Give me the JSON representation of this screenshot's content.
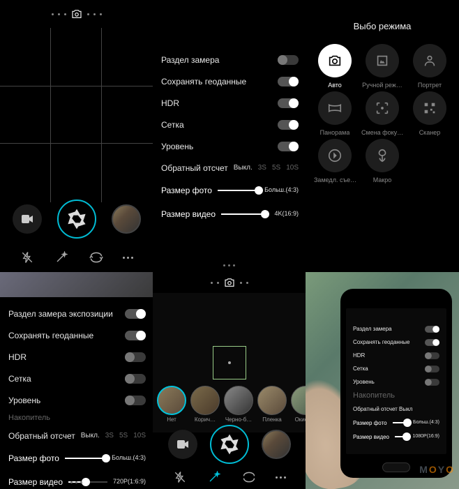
{
  "panel1": {
    "mode_icon": "camera-icon"
  },
  "panel2": {
    "rows": [
      {
        "label": "Раздел замера",
        "on": false
      },
      {
        "label": "Сохранять геоданные",
        "on": true
      },
      {
        "label": "HDR",
        "on": true
      },
      {
        "label": "Сетка",
        "on": true
      },
      {
        "label": "Уровень",
        "on": true
      }
    ],
    "timer_label": "Обратный отсчет",
    "timer_opts": [
      "Выкл.",
      "3S",
      "5S",
      "10S"
    ],
    "timer_sel": "Выкл.",
    "photo_size_label": "Размер фото",
    "photo_size_val": "Больш.(4:3)",
    "photo_size_pct": 100,
    "video_size_label": "Размер видео",
    "video_size_val": "4K(16:9)",
    "video_size_pct": 100
  },
  "panel3": {
    "title": "Выбо режима",
    "modes": [
      {
        "icon": "camera",
        "label": "Авто",
        "active": true
      },
      {
        "icon": "manual",
        "label": "Ручной реж…",
        "active": false
      },
      {
        "icon": "portrait",
        "label": "Портрет",
        "active": false
      },
      {
        "icon": "panorama",
        "label": "Панорама",
        "active": false
      },
      {
        "icon": "focus",
        "label": "Смена фоку…",
        "active": false
      },
      {
        "icon": "qr",
        "label": "Сканер",
        "active": false
      },
      {
        "icon": "slowmo",
        "label": "Замедл. съе…",
        "active": false
      },
      {
        "icon": "macro",
        "label": "Макро",
        "active": false
      }
    ]
  },
  "panel4": {
    "rows": [
      {
        "label": "Раздел замера экспозиции",
        "on": true
      },
      {
        "label": "Сохранять геоданные",
        "on": true
      },
      {
        "label": "HDR",
        "on": false
      },
      {
        "label": "Сетка",
        "on": false
      },
      {
        "label": "Уровень",
        "on": false
      }
    ],
    "storage_hdr": "Накопитель",
    "timer_label": "Обратный отсчет",
    "timer_opts": [
      "Выкл.",
      "3S",
      "5S",
      "10S"
    ],
    "timer_sel": "Выкл.",
    "photo_size_label": "Размер фото",
    "photo_size_val": "Больш.(4:3)",
    "photo_size_pct": 100,
    "video_size_label": "Размер видео",
    "video_size_val": "720P(1:6:9)",
    "video_size_pct": 45
  },
  "panel5": {
    "filters": [
      {
        "label": "Нет",
        "sel": true,
        "bg": "linear-gradient(135deg,#8a7a5a,#5a4a3a)"
      },
      {
        "label": "Корич…",
        "sel": false,
        "bg": "linear-gradient(135deg,#7a6a4a,#4a3a2a)"
      },
      {
        "label": "Черно-б…",
        "sel": false,
        "bg": "linear-gradient(135deg,#888,#333)"
      },
      {
        "label": "Пленка",
        "sel": false,
        "bg": "linear-gradient(135deg,#9a8a6a,#5a4a3a)"
      },
      {
        "label": "Окисл…",
        "sel": false,
        "bg": "linear-gradient(135deg,#8a9a7a,#4a5a4a)"
      }
    ]
  },
  "panel6": {
    "rows": [
      {
        "label": "Раздел замера",
        "on": true
      },
      {
        "label": "Сохранять геоданные",
        "on": true
      },
      {
        "label": "HDR",
        "on": false
      },
      {
        "label": "Сетка",
        "on": false
      },
      {
        "label": "Уровень",
        "on": false
      }
    ],
    "storage_hdr": "Накопитель",
    "timer_label": "Обратный отсчет Выкл",
    "photo_size_label": "Размер фото",
    "photo_size_val": "Больш.(4:3)",
    "video_size_label": "Размер видео",
    "video_size_val": "1080P(16:9)"
  }
}
